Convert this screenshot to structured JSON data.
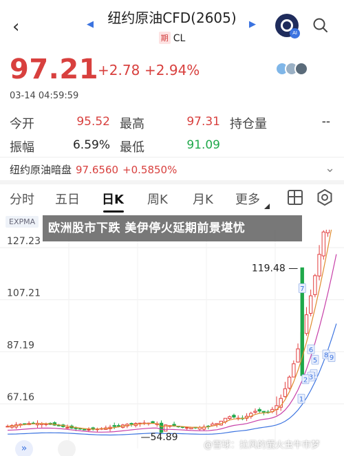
{
  "header": {
    "back_icon": "chevron-left-icon",
    "title": "纽约原油CFD(2605)",
    "subtitle_badge": "期",
    "subtitle_code": "CL"
  },
  "quote": {
    "price": "97.21",
    "change": "+2.78",
    "change_pct": "+2.94%",
    "time": "03-14 04:59:59"
  },
  "stats": [
    {
      "label": "今开",
      "value": "95.52"
    },
    {
      "label": "最高",
      "value": "97.31"
    },
    {
      "label": "持仓量",
      "value": "--"
    },
    {
      "label": "振幅",
      "value": "6.59%"
    },
    {
      "label": "最低",
      "value": "91.09"
    }
  ],
  "dark_pool": {
    "label": "纽约原油暗盘",
    "price": "97.6560",
    "change": "+0.5850%"
  },
  "tabs": [
    "分时",
    "五日",
    "日K",
    "周K",
    "月K",
    "更多"
  ],
  "active_tab": "日K",
  "ma_label": "EXPMA",
  "banner_text": "欧洲股市下跌 美伊停火延期前景堪忧",
  "chart_data": {
    "type": "candlestick",
    "y_ticks": [
      "127.23",
      "107.21",
      "87.19",
      "67.16"
    ],
    "ylim": [
      50,
      132
    ],
    "annotations": {
      "high_label": "119.48",
      "low_label": "54.89",
      "markers": [
        "7",
        "6",
        "5",
        "4",
        "3",
        "2",
        "1",
        "8",
        "9"
      ]
    }
  },
  "watermark": "@雪球：拉风的萤火虫牛市梦",
  "colors": {
    "up": "#e23b3b",
    "down": "#1fa84a",
    "accent": "#3b73e0"
  }
}
